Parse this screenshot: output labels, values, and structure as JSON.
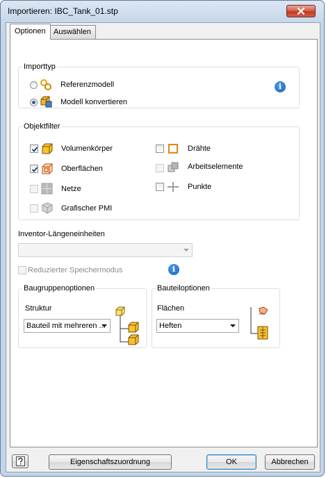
{
  "window": {
    "title": "Importieren: IBC_Tank_01.stp"
  },
  "tabs": [
    {
      "label": "Optionen"
    },
    {
      "label": "Auswählen"
    }
  ],
  "importtyp": {
    "legend": "Importtyp",
    "options": [
      {
        "label": "Referenzmodell",
        "selected": false,
        "icon": "reference-chain-icon"
      },
      {
        "label": "Modell konvertieren",
        "selected": true,
        "icon": "convert-model-icon"
      }
    ]
  },
  "objektfilter": {
    "legend": "Objektfilter",
    "items": [
      {
        "label": "Volumenkörper",
        "checked": true,
        "enabled": true,
        "icon": "solid-body-icon"
      },
      {
        "label": "Oberflächen",
        "checked": true,
        "enabled": true,
        "icon": "surface-icon"
      },
      {
        "label": "Netze",
        "checked": false,
        "enabled": false,
        "icon": "mesh-icon"
      },
      {
        "label": "Grafischer PMI",
        "checked": false,
        "enabled": false,
        "icon": "pmi-icon"
      },
      {
        "label": "Drähte",
        "checked": false,
        "enabled": true,
        "icon": "wire-icon"
      },
      {
        "label": "Arbeitselemente",
        "checked": false,
        "enabled": false,
        "icon": "work-feature-icon"
      },
      {
        "label": "Punkte",
        "checked": false,
        "enabled": true,
        "icon": "point-icon"
      }
    ]
  },
  "units": {
    "label": "Inventor-Längeneinheiten",
    "value": ""
  },
  "reduced_memory": {
    "label": "Reduzierter Speichermodus",
    "checked": false,
    "enabled": false
  },
  "assembly": {
    "legend": "Baugruppenoptionen",
    "structure_label": "Struktur",
    "structure_value": "Bauteil mit mehreren ..."
  },
  "part": {
    "legend": "Bauteiloptionen",
    "surfaces_label": "Flächen",
    "surfaces_value": "Heften"
  },
  "footer": {
    "help_icon": "help-icon",
    "mapping_button": "Eigenschaftszuordnung",
    "ok_button": "OK",
    "cancel_button": "Abbrechen"
  },
  "colors": {
    "accent": "#2f5ea8",
    "icon_orange": "#e8850e",
    "close_red": "#c0391f"
  }
}
